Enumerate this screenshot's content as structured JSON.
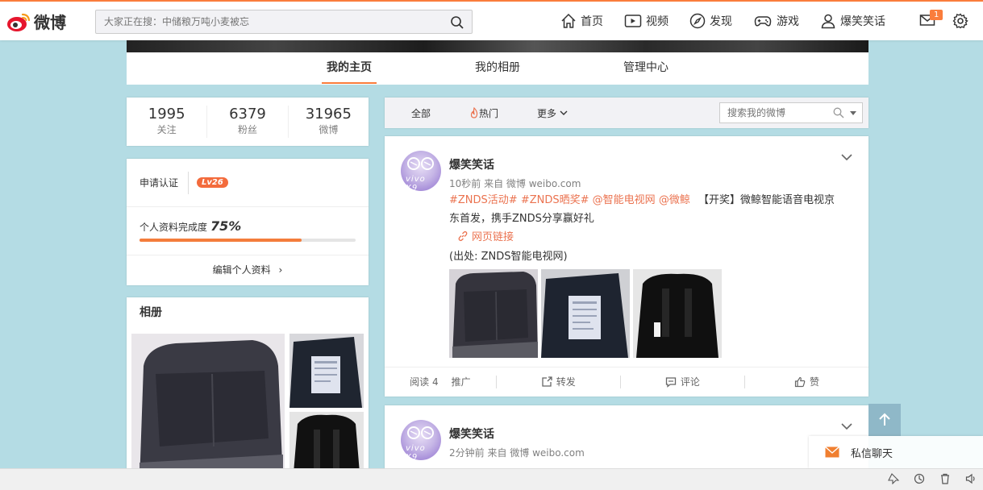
{
  "brand": {
    "name": "微博"
  },
  "search": {
    "placeholder": "大家正在搜：中储粮万吨小麦被忘"
  },
  "nav": [
    {
      "label": "首页",
      "icon": "home-icon"
    },
    {
      "label": "视频",
      "icon": "video-icon"
    },
    {
      "label": "发现",
      "icon": "compass-icon"
    },
    {
      "label": "游戏",
      "icon": "gamepad-icon"
    },
    {
      "label": "爆笑笑话",
      "icon": "user-icon"
    }
  ],
  "messages_badge": "1",
  "tabs": [
    "我的主页",
    "我的相册",
    "管理中心"
  ],
  "stats": [
    {
      "num": "1995",
      "label": "关注"
    },
    {
      "num": "6379",
      "label": "粉丝"
    },
    {
      "num": "31965",
      "label": "微博"
    }
  ],
  "profile": {
    "verify_label": "申请认证",
    "level": "Lv26",
    "complete_label": "个人资料完成度",
    "complete_pct": "75%",
    "complete_value": 0.75,
    "edit_label": "编辑个人资料"
  },
  "album": {
    "title": "相册"
  },
  "feed_filter": {
    "all": "全部",
    "hot": "热门",
    "more": "更多",
    "search_placeholder": "搜索我的微博"
  },
  "posts": [
    {
      "author": "爆笑笑话",
      "meta": "10秒前 来自 微博 weibo.com",
      "tags": [
        "#ZNDS活动#",
        "#ZNDS晒奖#",
        "@智能电视网",
        "@微鲸"
      ],
      "text_a": "【开奖】微鲸智能语音电视京",
      "text_b": "东首发，携手ZNDS分享赢好礼",
      "link": "网页链接",
      "source": "(出处: ZNDS智能电视网)",
      "avatar_text": "vivo X9",
      "actions": {
        "read": "阅读 4",
        "promote": "推广",
        "repost": "转发",
        "comment": "评论",
        "like": "赞"
      }
    },
    {
      "author": "爆笑笑话",
      "meta": "2分钟前 来自 微博 weibo.com",
      "avatar_text": "vivo X9"
    }
  ],
  "chat": {
    "label": "私信聊天"
  },
  "colors": {
    "accent": "#fa7d3c",
    "link": "#eb7350",
    "background": "#b4dce4"
  }
}
